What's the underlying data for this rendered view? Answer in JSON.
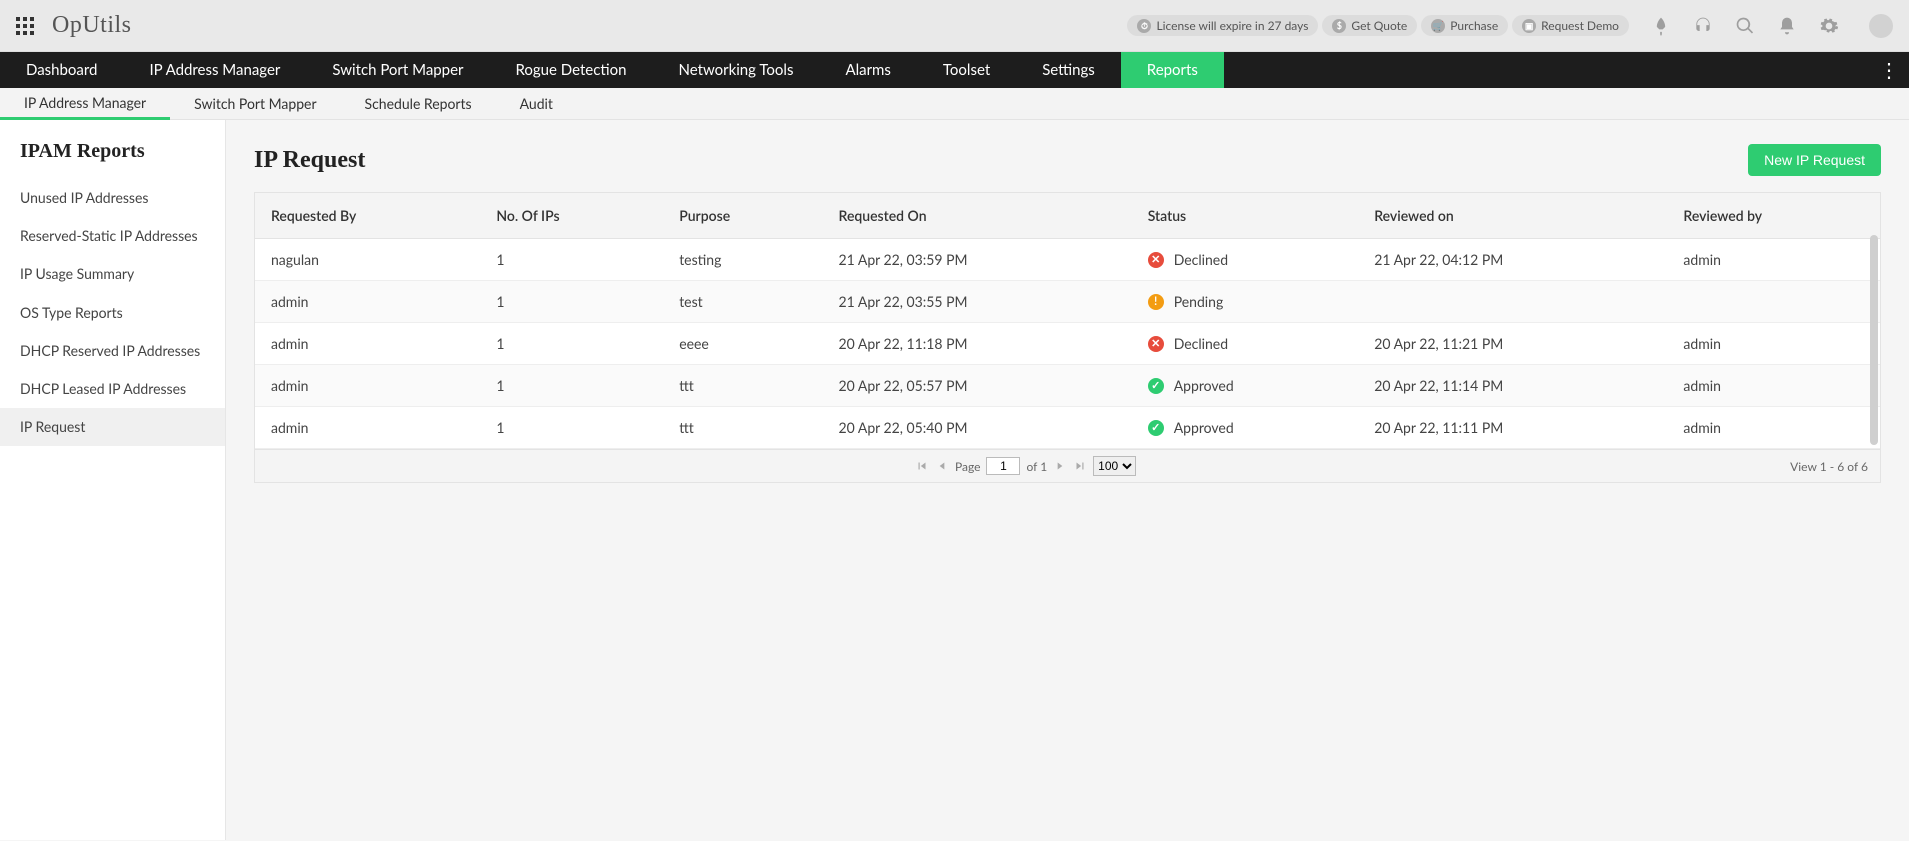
{
  "header": {
    "app_title": "OpUtils",
    "chips": [
      {
        "icon": "⏱",
        "label": "License will expire in 27 days"
      },
      {
        "icon": "$",
        "label": "Get Quote"
      },
      {
        "icon": "🛒",
        "label": "Purchase"
      },
      {
        "icon": "▣",
        "label": "Request Demo"
      }
    ]
  },
  "primary_nav": [
    {
      "label": "Dashboard",
      "active": false
    },
    {
      "label": "IP Address Manager",
      "active": false
    },
    {
      "label": "Switch Port Mapper",
      "active": false
    },
    {
      "label": "Rogue Detection",
      "active": false
    },
    {
      "label": "Networking Tools",
      "active": false
    },
    {
      "label": "Alarms",
      "active": false
    },
    {
      "label": "Toolset",
      "active": false
    },
    {
      "label": "Settings",
      "active": false
    },
    {
      "label": "Reports",
      "active": true
    }
  ],
  "secondary_nav": [
    {
      "label": "IP Address Manager",
      "active": true
    },
    {
      "label": "Switch Port Mapper",
      "active": false
    },
    {
      "label": "Schedule Reports",
      "active": false
    },
    {
      "label": "Audit",
      "active": false
    }
  ],
  "sidebar": {
    "title": "IPAM Reports",
    "items": [
      {
        "label": "Unused IP Addresses",
        "active": false
      },
      {
        "label": "Reserved-Static IP Addresses",
        "active": false
      },
      {
        "label": "IP Usage Summary",
        "active": false
      },
      {
        "label": "OS Type Reports",
        "active": false
      },
      {
        "label": "DHCP Reserved IP Addresses",
        "active": false
      },
      {
        "label": "DHCP Leased IP Addresses",
        "active": false
      },
      {
        "label": "IP Request",
        "active": true
      }
    ]
  },
  "main": {
    "title": "IP Request",
    "new_button": "New IP Request",
    "columns": [
      "Requested By",
      "No. Of IPs",
      "Purpose",
      "Requested On",
      "Status",
      "Reviewed on",
      "Reviewed by"
    ],
    "rows": [
      {
        "by": "nagulan",
        "ips": "1",
        "purpose": "testing",
        "on": "21 Apr 22, 03:59 PM",
        "status": "Declined",
        "rev_on": "21 Apr 22, 04:12 PM",
        "rev_by": "admin"
      },
      {
        "by": "admin",
        "ips": "1",
        "purpose": "test",
        "on": "21 Apr 22, 03:55 PM",
        "status": "Pending",
        "rev_on": "",
        "rev_by": ""
      },
      {
        "by": "admin",
        "ips": "1",
        "purpose": "eeee",
        "on": "20 Apr 22, 11:18 PM",
        "status": "Declined",
        "rev_on": "20 Apr 22, 11:21 PM",
        "rev_by": "admin"
      },
      {
        "by": "admin",
        "ips": "1",
        "purpose": "ttt",
        "on": "20 Apr 22, 05:57 PM",
        "status": "Approved",
        "rev_on": "20 Apr 22, 11:14 PM",
        "rev_by": "admin"
      },
      {
        "by": "admin",
        "ips": "1",
        "purpose": "ttt",
        "on": "20 Apr 22, 05:40 PM",
        "status": "Approved",
        "rev_on": "20 Apr 22, 11:11 PM",
        "rev_by": "admin"
      }
    ],
    "pager": {
      "page_label": "Page",
      "page_value": "1",
      "of_label": "of 1",
      "page_size": "100",
      "summary": "View 1 - 6 of 6"
    }
  }
}
